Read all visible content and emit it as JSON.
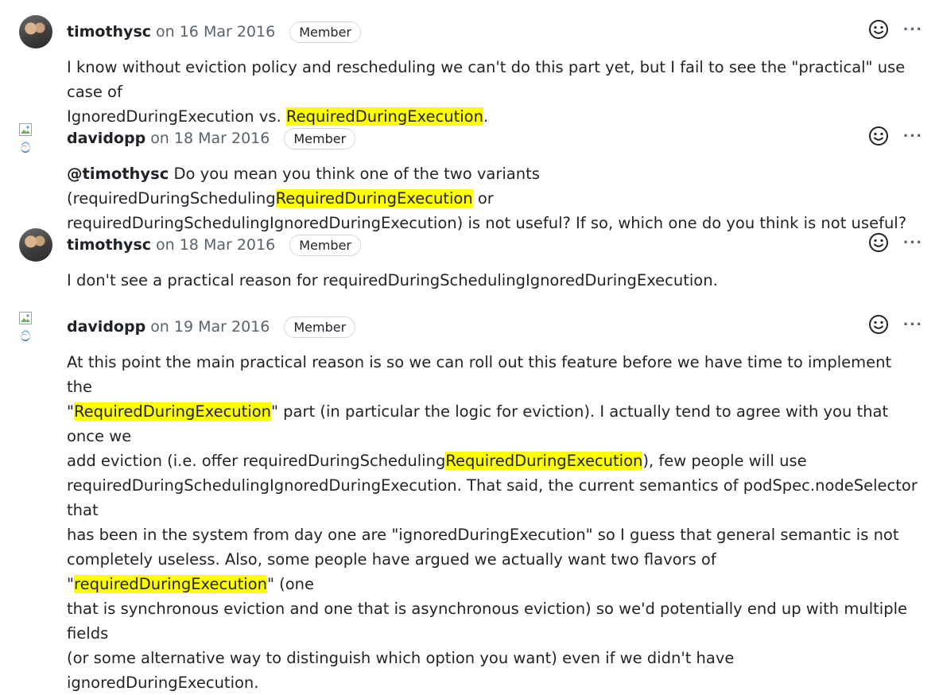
{
  "comments": [
    {
      "author": "timothysc",
      "date": "on 16 Mar 2016",
      "role": "Member",
      "avatar": "photo",
      "p1": "I know without eviction policy and rescheduling we can't do this part yet, but I fail to see the \"practical\" use case of",
      "p2": "IgnoredDuringExecution vs. ",
      "p2_hl": "RequiredDuringExecution",
      "p2_end": "."
    },
    {
      "author": "davidopp",
      "date": "on 18 Mar 2016",
      "role": "Member",
      "avatar": "broken-image",
      "avatar_alt": "ට්",
      "mention": "@timothysc",
      "p1": " Do you mean you think one of the two variants (requiredDuringScheduling",
      "p1_hl": "RequiredDuringExecution",
      "p1_end": " or",
      "p2": "requiredDuringSchedulingIgnoredDuringExecution) is not useful? If so, which one do you think is not useful?"
    },
    {
      "author": "timothysc",
      "date": "on 18 Mar 2016",
      "role": "Member",
      "avatar": "photo",
      "p1": "I don't see a practical reason for requiredDuringSchedulingIgnoredDuringExecution."
    },
    {
      "author": "davidopp",
      "date": "on 19 Mar 2016",
      "role": "Member",
      "avatar": "broken-image",
      "avatar_alt": "ට්",
      "l1": "At this point the main practical reason is so we can roll out this feature before we have time to implement the",
      "l2a": "\"",
      "l2hl": "RequiredDuringExecution",
      "l2b": "\" part (in particular the logic for eviction). I actually tend to agree with you that once we",
      "l3a": "add eviction (i.e. offer requiredDuringScheduling",
      "l3hl": "RequiredDuringExecution",
      "l3b": "), few people will use",
      "l4": "requiredDuringSchedulingIgnoredDuringExecution. That said, the current semantics of podSpec.nodeSelector that",
      "l5": "has been in the system from day one are \"ignoredDuringExecution\" so I guess that general semantic is not",
      "l6a": "completely useless. Also, some people have argued we actually want two flavors of \"",
      "l6hl": "requiredDuringExecution",
      "l6b": "\" (one",
      "l7": "that is synchronous eviction and one that is asynchronous eviction) so we'd potentially end up with multiple fields",
      "l8": "(or some alternative way to distinguish which option you want) even if we didn't have ignoredDuringExecution."
    }
  ],
  "icons": {
    "reaction": "smiley-icon",
    "more": "kebab-horizontal-icon"
  },
  "more_glyph": "···"
}
